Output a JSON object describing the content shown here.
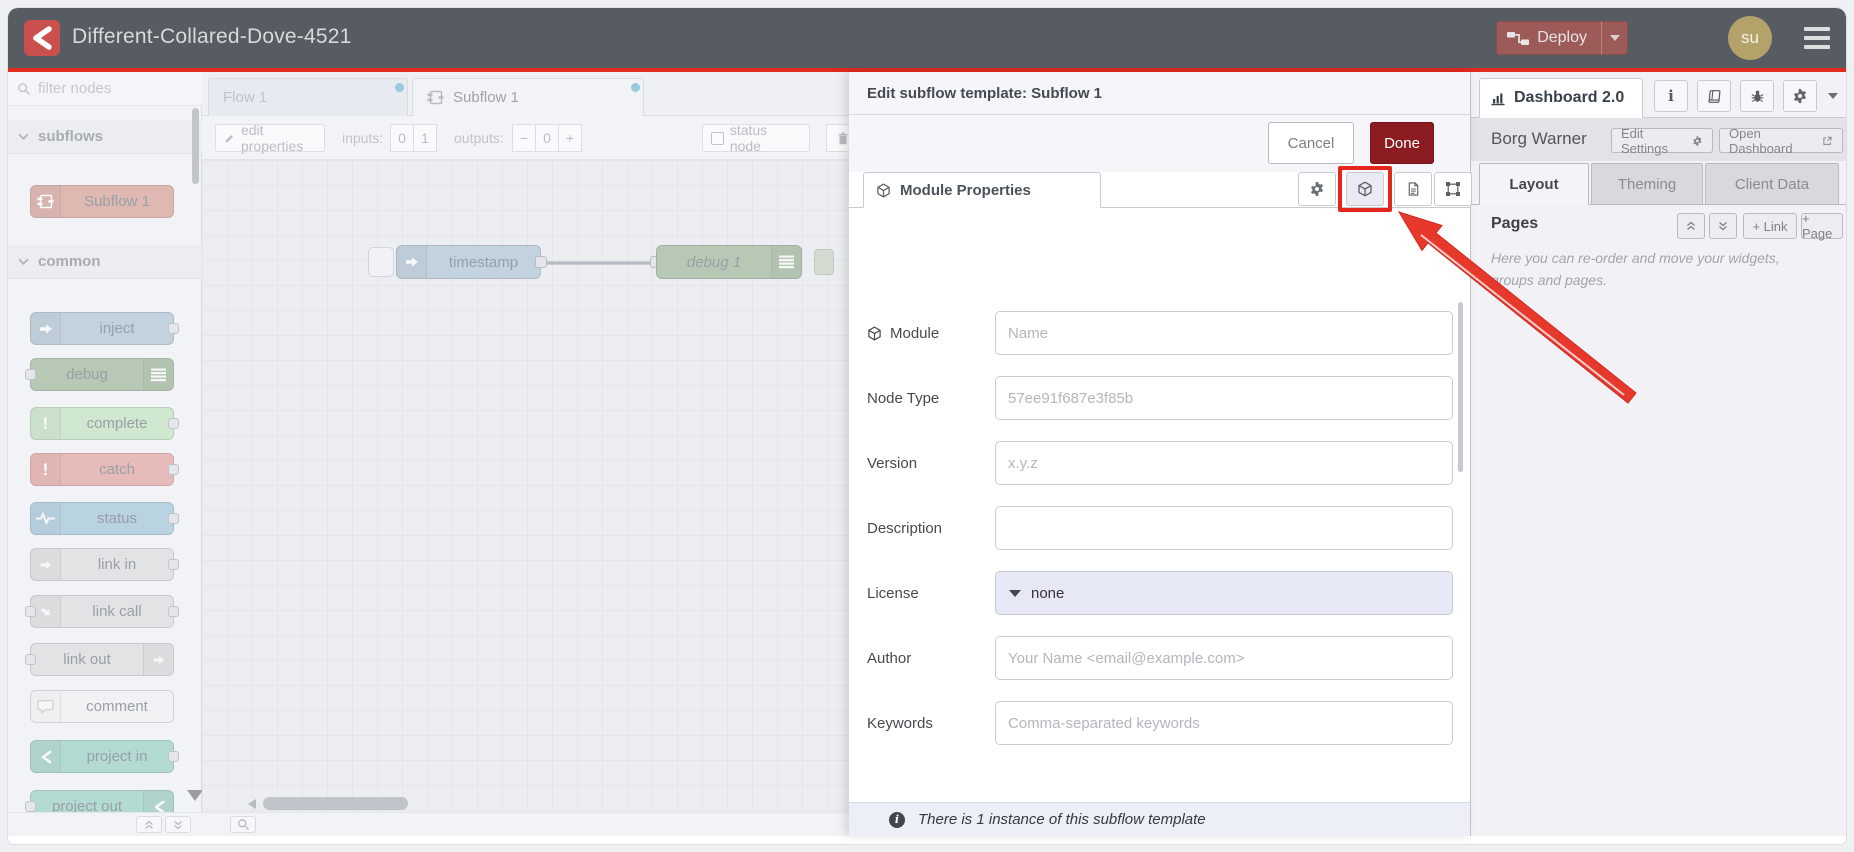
{
  "header": {
    "title": "Different-Collared-Dove-4521",
    "deploy": "Deploy",
    "avatar": "su"
  },
  "palette": {
    "filter_placeholder": "filter nodes",
    "categories": [
      {
        "label": "subflows"
      },
      {
        "label": "common"
      }
    ],
    "nodes": [
      {
        "label": "Subflow 1",
        "color": "#cf8a7e"
      },
      {
        "label": "inject",
        "color": "#9fb7cc"
      },
      {
        "label": "debug",
        "color": "#8aa883"
      },
      {
        "label": "complete",
        "color": "#b7dcb2"
      },
      {
        "label": "catch",
        "color": "#dd8f8a"
      },
      {
        "label": "status",
        "color": "#8fb9cf"
      },
      {
        "label": "link in",
        "color": "#d4d4d4"
      },
      {
        "label": "link call",
        "color": "#d4d4d4"
      },
      {
        "label": "link out",
        "color": "#d4d4d4"
      },
      {
        "label": "comment",
        "color": "#eeeeee"
      },
      {
        "label": "project in",
        "color": "#86c5b8"
      },
      {
        "label": "project out",
        "color": "#86c5b8"
      }
    ]
  },
  "workspace": {
    "tabs": [
      {
        "label": "Flow 1"
      },
      {
        "label": "Subflow 1"
      }
    ],
    "toolbar": {
      "edit_properties": "edit properties",
      "inputs_label": "inputs:",
      "input_options": [
        "0",
        "1"
      ],
      "outputs_label": "outputs:",
      "minus": "−",
      "outputs_value": "0",
      "plus": "+",
      "status_node": "status node"
    },
    "nodes": [
      {
        "label": "timestamp",
        "color": "#9fb7cc"
      },
      {
        "label": "debug 1",
        "color": "#8aa883"
      }
    ]
  },
  "tray": {
    "title": "Edit subflow template: Subflow 1",
    "cancel": "Cancel",
    "done": "Done",
    "tab": "Module Properties",
    "fields": [
      {
        "label": "Module",
        "placeholder": "Name"
      },
      {
        "label": "Node Type",
        "placeholder": "57ee91f687e3f85b"
      },
      {
        "label": "Version",
        "placeholder": "x.y.z"
      },
      {
        "label": "Description",
        "placeholder": ""
      },
      {
        "label": "License",
        "value": "none"
      },
      {
        "label": "Author",
        "placeholder": "Your Name <email@example.com>"
      },
      {
        "label": "Keywords",
        "placeholder": "Comma-separated keywords"
      }
    ],
    "footer": "There is 1 instance of this subflow template"
  },
  "sidebar": {
    "tab": "Dashboard 2.0",
    "project": "Borg Warner",
    "edit_settings": "Edit Settings",
    "open_dashboard": "Open Dashboard",
    "tabs": [
      {
        "label": "Layout"
      },
      {
        "label": "Theming"
      },
      {
        "label": "Client Data"
      }
    ],
    "pages": {
      "title": "Pages",
      "link": "+ Link",
      "page": "+ Page"
    },
    "help": "Here you can re-order and move your widgets, groups and pages."
  },
  "colors": {
    "header_bg": "#575c63",
    "accent_red": "#e02b1e",
    "deploy_bg": "#9c5b59",
    "done_bg": "#8c1c21",
    "tab_dot": "#55a8c6",
    "wire": "#888f9b"
  }
}
